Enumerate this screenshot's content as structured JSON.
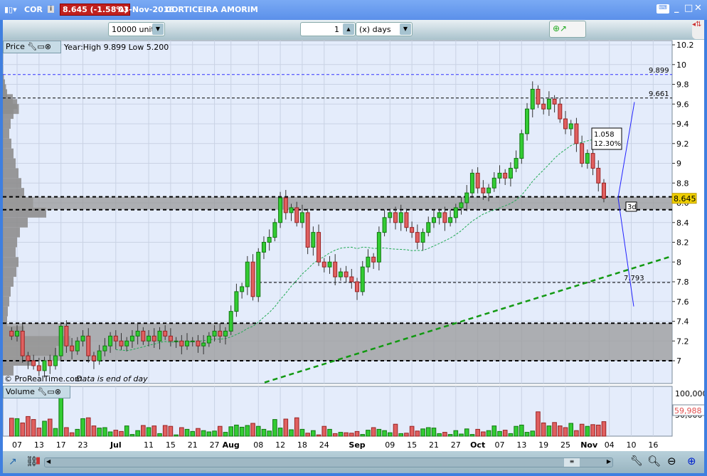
{
  "titlebar": {
    "symbol": "COR",
    "price_badge": "8.645 (-1.58%)",
    "date": "03-Nov-2016",
    "name": "CORTICEIRA AMORIM",
    "accent": "#c0201e"
  },
  "toolbar": {
    "units": "10000 units",
    "period_value": "1",
    "period_unit": "(x) days"
  },
  "price_panel": {
    "title": "Price",
    "info": "Year:High 9.899 Low 5.200",
    "watermark": "© ProRealTime.com",
    "data_note": "Data is end of day"
  },
  "volume_panel": {
    "title": "Volume"
  },
  "chart_data": {
    "type": "candlestick",
    "title": "CORTICEIRA AMORIM (COR) daily",
    "ylim": [
      6.85,
      10.25
    ],
    "y_ticks": [
      "10.2",
      "10",
      "9.8",
      "9.6",
      "9.4",
      "9.2",
      "9",
      "8.8",
      "8.6",
      "8.4",
      "8.2",
      "8",
      "7.8",
      "7.6",
      "7.4",
      "7.2",
      "7"
    ],
    "x_ticks": [
      {
        "label": "07",
        "i": 1
      },
      {
        "label": "13",
        "i": 5
      },
      {
        "label": "17",
        "i": 9
      },
      {
        "label": "23",
        "i": 13
      },
      {
        "label": "Jul",
        "i": 19,
        "bold": true
      },
      {
        "label": "11",
        "i": 25
      },
      {
        "label": "15",
        "i": 29
      },
      {
        "label": "21",
        "i": 33
      },
      {
        "label": "27",
        "i": 37
      },
      {
        "label": "Aug",
        "i": 40,
        "bold": true
      },
      {
        "label": "08",
        "i": 45
      },
      {
        "label": "12",
        "i": 49
      },
      {
        "label": "18",
        "i": 53
      },
      {
        "label": "24",
        "i": 57
      },
      {
        "label": "Sep",
        "i": 63,
        "bold": true
      },
      {
        "label": "09",
        "i": 69
      },
      {
        "label": "15",
        "i": 73
      },
      {
        "label": "21",
        "i": 77
      },
      {
        "label": "27",
        "i": 81
      },
      {
        "label": "Oct",
        "i": 85,
        "bold": true
      },
      {
        "label": "07",
        "i": 89
      },
      {
        "label": "13",
        "i": 93
      },
      {
        "label": "19",
        "i": 97
      },
      {
        "label": "25",
        "i": 101
      },
      {
        "label": "Nov",
        "i": 105.3,
        "bold": true
      },
      {
        "label": "04",
        "i": 109
      },
      {
        "label": "10",
        "i": 113
      },
      {
        "label": "16",
        "i": 117
      }
    ],
    "closes": [
      7.25,
      7.3,
      7.05,
      7.0,
      6.95,
      6.9,
      7.0,
      6.95,
      7.05,
      7.35,
      7.15,
      7.1,
      7.2,
      7.25,
      7.05,
      7.0,
      7.1,
      7.15,
      7.25,
      7.2,
      7.15,
      7.2,
      7.25,
      7.3,
      7.2,
      7.25,
      7.2,
      7.3,
      7.25,
      7.2,
      7.2,
      7.15,
      7.2,
      7.2,
      7.15,
      7.18,
      7.25,
      7.3,
      7.25,
      7.3,
      7.5,
      7.7,
      7.75,
      8.0,
      7.65,
      8.1,
      8.2,
      8.25,
      8.4,
      8.65,
      8.5,
      8.55,
      8.4,
      8.5,
      8.15,
      8.3,
      8.0,
      7.95,
      8.0,
      7.85,
      7.9,
      7.85,
      7.8,
      7.7,
      7.95,
      8.05,
      8.0,
      8.3,
      8.45,
      8.5,
      8.4,
      8.5,
      8.35,
      8.3,
      8.2,
      8.3,
      8.4,
      8.45,
      8.5,
      8.4,
      8.45,
      8.55,
      8.6,
      8.7,
      8.9,
      8.75,
      8.7,
      8.75,
      8.85,
      8.9,
      8.85,
      8.95,
      9.05,
      9.3,
      9.55,
      9.75,
      9.6,
      9.55,
      9.65,
      9.6,
      9.45,
      9.35,
      9.4,
      9.2,
      9.0,
      9.1,
      8.95,
      8.8,
      8.645
    ],
    "volumes": [
      42,
      41,
      31,
      46,
      39,
      19,
      35,
      40,
      18,
      98,
      20,
      8,
      16,
      41,
      43,
      24,
      19,
      20,
      10,
      14,
      11,
      24,
      4,
      13,
      25,
      20,
      24,
      6,
      25,
      23,
      3,
      20,
      16,
      11,
      18,
      13,
      10,
      12,
      23,
      9,
      22,
      26,
      21,
      25,
      30,
      23,
      16,
      12,
      39,
      19,
      40,
      15,
      43,
      16,
      7,
      13,
      3,
      23,
      16,
      6,
      9,
      8,
      7,
      11,
      4,
      14,
      20,
      16,
      13,
      8,
      28,
      6,
      7,
      23,
      12,
      17,
      20,
      19,
      6,
      9,
      4,
      13,
      5,
      17,
      4,
      16,
      10,
      13,
      24,
      11,
      14,
      6,
      23,
      26,
      9,
      12,
      57,
      31,
      24,
      32,
      24,
      20,
      30,
      13,
      28,
      23,
      27,
      26,
      34
    ],
    "volume_unit": "thousands",
    "volume_ticks": [
      "100,000",
      "50,000"
    ],
    "last_volume": "59,988",
    "levels": [
      {
        "value": 9.899,
        "label": "9.899",
        "color": "#3333ff"
      },
      {
        "value": 9.661,
        "label": "9.661",
        "color": "#000000"
      },
      {
        "value": 7.793,
        "label": "7.793",
        "color": "#000000"
      }
    ],
    "zones": [
      [
        8.53,
        8.66
      ],
      [
        7.0,
        7.38
      ]
    ],
    "last_price": "8.645",
    "annotation": {
      "line1": "1.058",
      "line2": "12.30%"
    },
    "projection_label": "3d",
    "volume_profile": [
      [
        9.85,
        3
      ],
      [
        9.8,
        6
      ],
      [
        9.75,
        9
      ],
      [
        9.7,
        12
      ],
      [
        9.65,
        28
      ],
      [
        9.6,
        40
      ],
      [
        9.55,
        45
      ],
      [
        9.5,
        30
      ],
      [
        9.4,
        22
      ],
      [
        9.3,
        18
      ],
      [
        9.2,
        24
      ],
      [
        9.1,
        30
      ],
      [
        9.0,
        36
      ],
      [
        8.9,
        44
      ],
      [
        8.8,
        52
      ],
      [
        8.7,
        60
      ],
      [
        8.6,
        85
      ],
      [
        8.5,
        122
      ],
      [
        8.4,
        70
      ],
      [
        8.3,
        48
      ],
      [
        8.2,
        40
      ],
      [
        8.1,
        36
      ],
      [
        8.0,
        44
      ],
      [
        7.9,
        38
      ],
      [
        7.8,
        30
      ],
      [
        7.7,
        22
      ],
      [
        7.6,
        18
      ],
      [
        7.5,
        14
      ],
      [
        7.4,
        12
      ],
      [
        7.3,
        60
      ],
      [
        7.2,
        190
      ],
      [
        7.1,
        150
      ],
      [
        7.0,
        80
      ],
      [
        6.9,
        30
      ]
    ],
    "colors": {
      "up": "#33cc33",
      "down": "#e06060",
      "ma": "#22aa55",
      "trend": "#119911"
    }
  }
}
